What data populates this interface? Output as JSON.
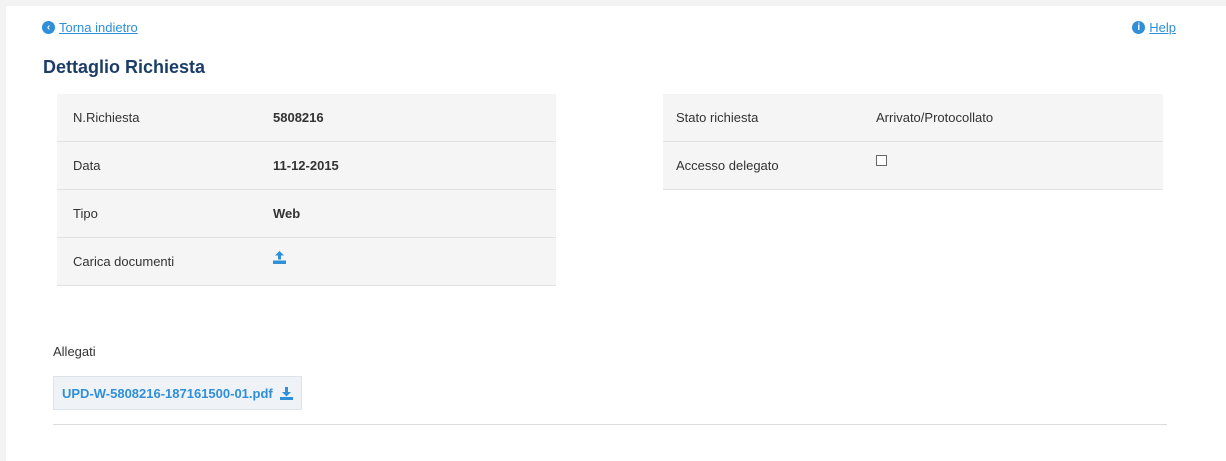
{
  "nav": {
    "back_label": "Torna indietro",
    "help_label": "Help"
  },
  "page": {
    "title": "Dettaglio Richiesta"
  },
  "details_left": [
    {
      "label": "N.Richiesta",
      "value": "5808216"
    },
    {
      "label": "Data",
      "value": "11-12-2015"
    },
    {
      "label": "Tipo",
      "value": "Web"
    },
    {
      "label": "Carica documenti",
      "icon": "upload-icon"
    }
  ],
  "details_right": [
    {
      "label": "Stato richiesta",
      "value": "Arrivato/Protocollato"
    },
    {
      "label": "Accesso delegato",
      "checked": false
    }
  ],
  "attachments": {
    "label": "Allegati",
    "files": [
      {
        "name": "UPD-W-5808216-187161500-01.pdf",
        "icon": "download-icon"
      }
    ]
  },
  "colors": {
    "link": "#2f8fd8",
    "title": "#1c3e66",
    "table_bg": "#f5f5f5"
  }
}
